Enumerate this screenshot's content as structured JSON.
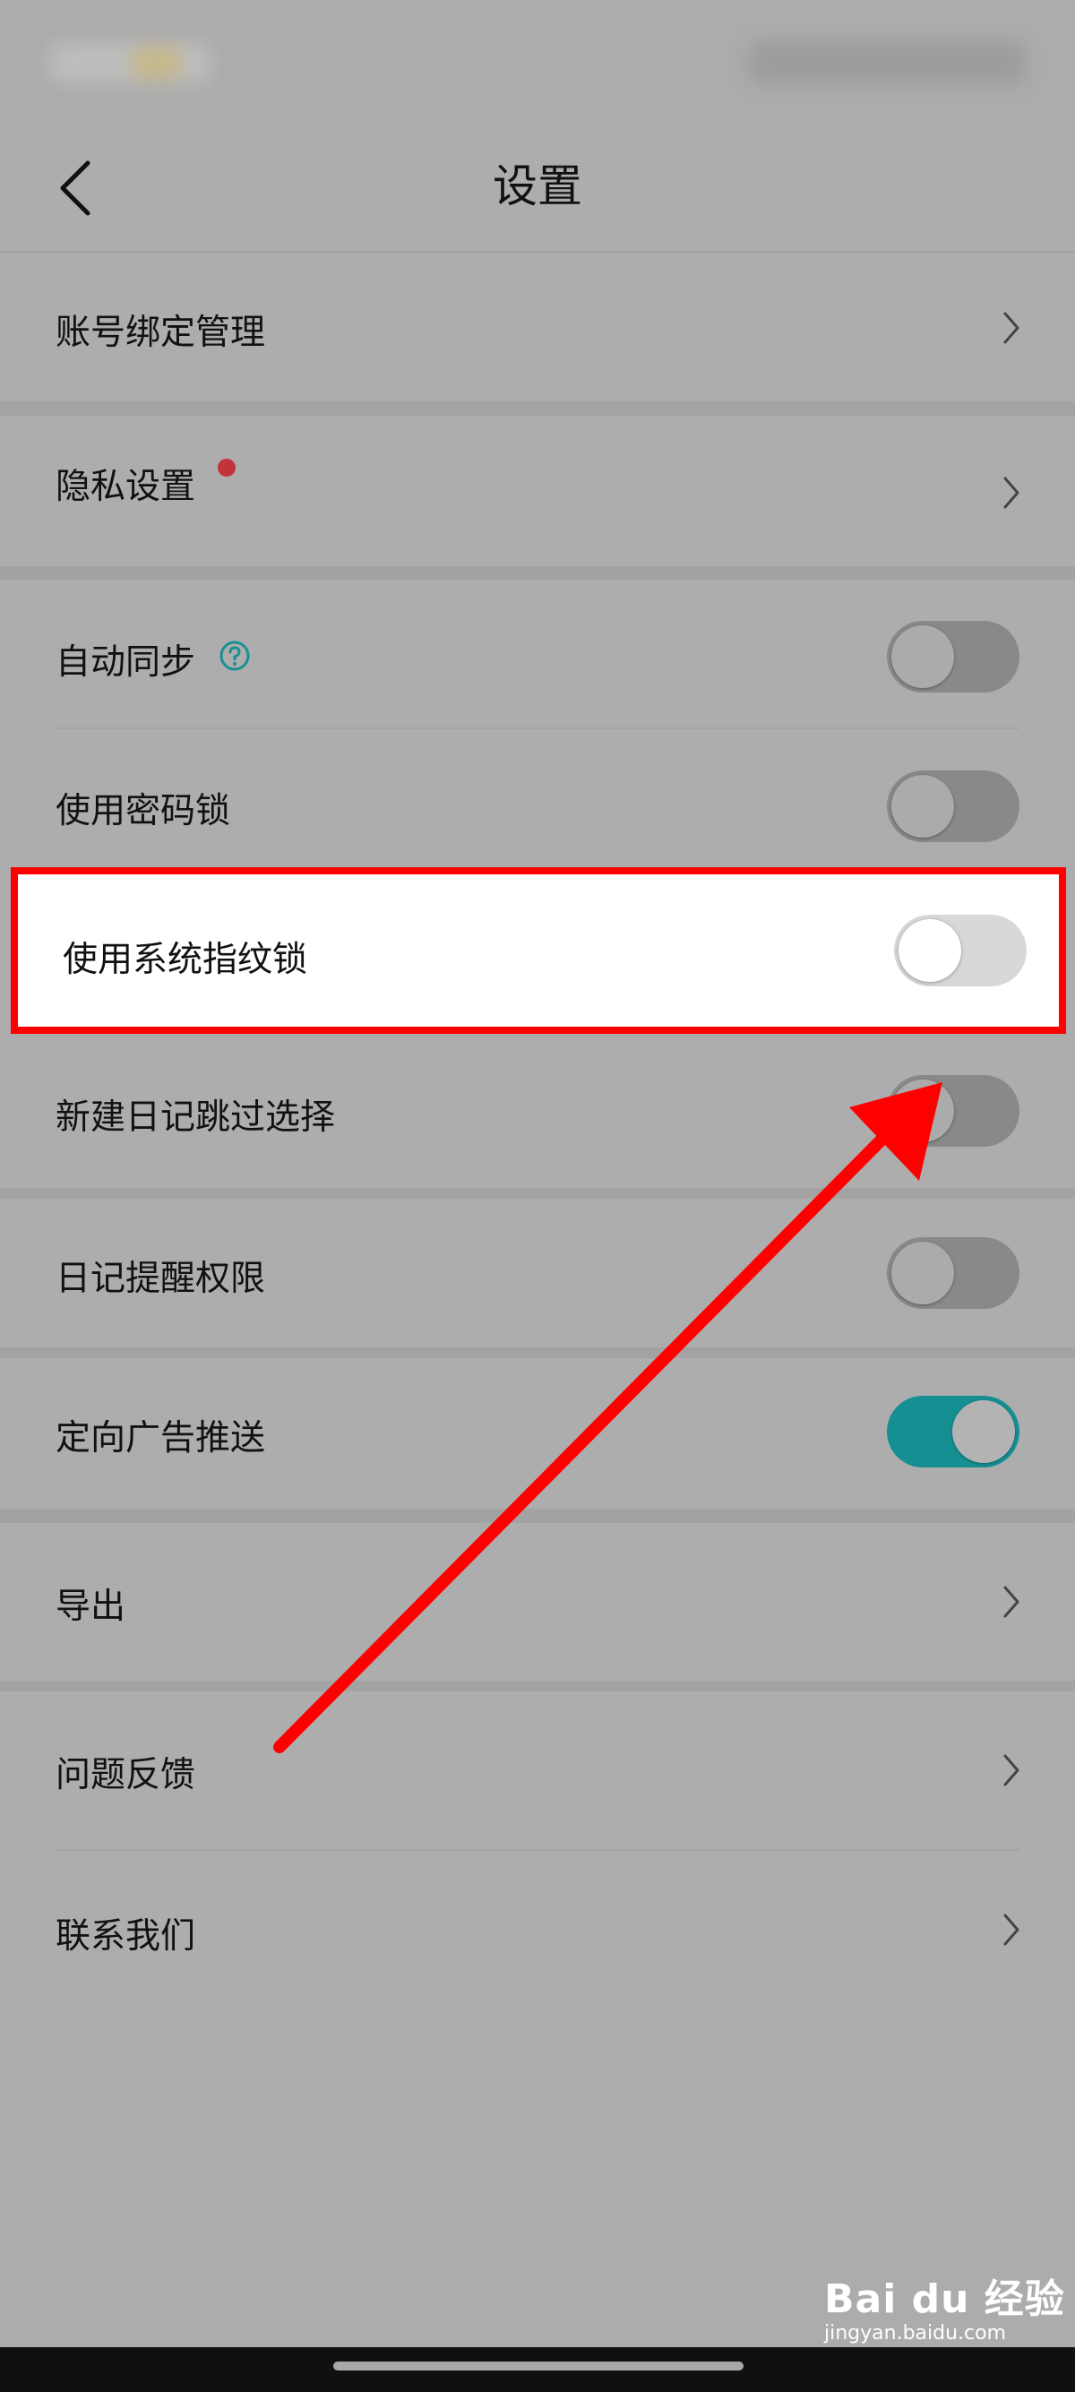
{
  "header": {
    "title": "设置"
  },
  "rows": {
    "account": {
      "label": "账号绑定管理"
    },
    "privacy": {
      "label": "隐私设置"
    },
    "autosync": {
      "label": "自动同步",
      "toggle": "off"
    },
    "passcode": {
      "label": "使用密码锁",
      "toggle": "off"
    },
    "fingerprint": {
      "label": "使用系统指纹锁",
      "toggle": "off"
    },
    "newdiary": {
      "label": "新建日记跳过选择",
      "toggle": "off"
    },
    "reminder": {
      "label": "日记提醒权限",
      "toggle": "off"
    },
    "ads": {
      "label": "定向广告推送",
      "toggle": "on"
    },
    "export": {
      "label": "导出"
    },
    "feedback": {
      "label": "问题反馈"
    },
    "contact": {
      "label": "联系我们"
    }
  },
  "watermark": {
    "brand": "Bai du 经验",
    "url": "jingyan.baidu.com"
  },
  "colors": {
    "accent": "#168f93",
    "highlight": "#ff0000",
    "badge": "#c2333a"
  },
  "icons": [
    "back-icon",
    "chevron-right-icon",
    "help-icon",
    "arrow-annotation"
  ]
}
